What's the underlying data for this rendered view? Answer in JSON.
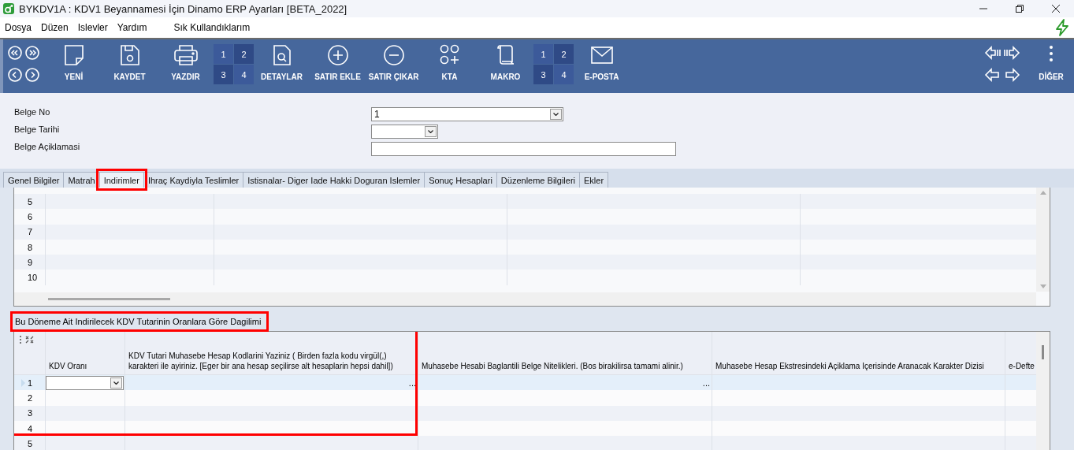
{
  "window": {
    "title": "BYKDV1A : KDV1 Beyannamesi İçin Dinamo ERP Ayarları [BETA_2022]"
  },
  "menu": [
    "Dosya",
    "Düzen",
    "Islevler",
    "Yardım",
    "Sık Kullandıklarım"
  ],
  "toolbar": {
    "items": [
      {
        "kind": "button",
        "label": "YENİ"
      },
      {
        "kind": "button",
        "label": "KAYDET"
      },
      {
        "kind": "button",
        "label": "YAZDIR"
      },
      {
        "kind": "pages",
        "cells": [
          "1",
          "2",
          "3",
          "4"
        ]
      },
      {
        "kind": "button",
        "label": "DETAYLAR"
      },
      {
        "kind": "button",
        "label": "SATIR EKLE"
      },
      {
        "kind": "button",
        "label": "SATIR ÇIKAR"
      },
      {
        "kind": "button",
        "label": "KTA"
      },
      {
        "kind": "button",
        "label": "MAKRO"
      },
      {
        "kind": "pages",
        "cells": [
          "1",
          "2",
          "3",
          "4"
        ]
      },
      {
        "kind": "button",
        "label": "E-POSTA"
      }
    ],
    "more_label": "DİĞER"
  },
  "form": [
    {
      "kind": "combo",
      "label": "Belge No",
      "value": "1"
    },
    {
      "kind": "date",
      "label": "Belge Tarihi"
    },
    {
      "kind": "text",
      "label": "Belge Açiklamasi"
    }
  ],
  "tabs": [
    {
      "label": "Genel Bilgiler",
      "selected": false,
      "highlighted": false
    },
    {
      "label": "Matrah",
      "selected": false,
      "highlighted": false
    },
    {
      "label": "Indirimler",
      "selected": true,
      "highlighted": true
    },
    {
      "label": "Ihraç Kaydiyla Teslimler",
      "selected": false,
      "highlighted": false
    },
    {
      "label": "Istisnalar- Diger Iade Hakki Doguran Islemler",
      "selected": false,
      "highlighted": false
    },
    {
      "label": "Sonuç Hesaplari",
      "selected": false,
      "highlighted": false
    },
    {
      "label": "Düzenleme Bilgileri",
      "selected": false,
      "highlighted": false
    },
    {
      "label": "Ekler",
      "selected": false,
      "highlighted": false
    }
  ],
  "upper_grid": {
    "rows": [
      "5",
      "6",
      "7",
      "8",
      "9",
      "10"
    ]
  },
  "section": {
    "title": "Bu Döneme Ait Indirilecek KDV Tutarinin Oranlara Göre Dagilimi",
    "highlighted": true
  },
  "lower_grid": {
    "highlighted": true,
    "columns": [
      {
        "heading": "KDV Oranı",
        "kind": "combo"
      },
      {
        "heading": "KDV Tutari Muhasebe Hesap Kodlarini Yaziniz ( Birden fazla kodu virgül(,)\nkarakteri ile ayiriniz. [Eger bir ana hesap seçilirse alt hesaplarin hepsi dahil])",
        "kind": "ellipsis",
        "button": "..."
      },
      {
        "heading": "Muhasebe Hesabi Baglantili Belge Nitelikleri. (Bos birakilirsa tamami alinir.)",
        "kind": "ellipsis",
        "button": "..."
      },
      {
        "heading": "Muhasebe Hesap Ekstresindeki Açiklama Içerisinde Aranacak Karakter Dizisi"
      },
      {
        "heading": "e-Defte"
      }
    ],
    "rows": [
      {
        "number": "1",
        "selected": true
      },
      {
        "number": "2",
        "selected": false
      },
      {
        "number": "3",
        "selected": false
      },
      {
        "number": "4",
        "selected": false
      },
      {
        "number": "5",
        "selected": false
      }
    ]
  }
}
